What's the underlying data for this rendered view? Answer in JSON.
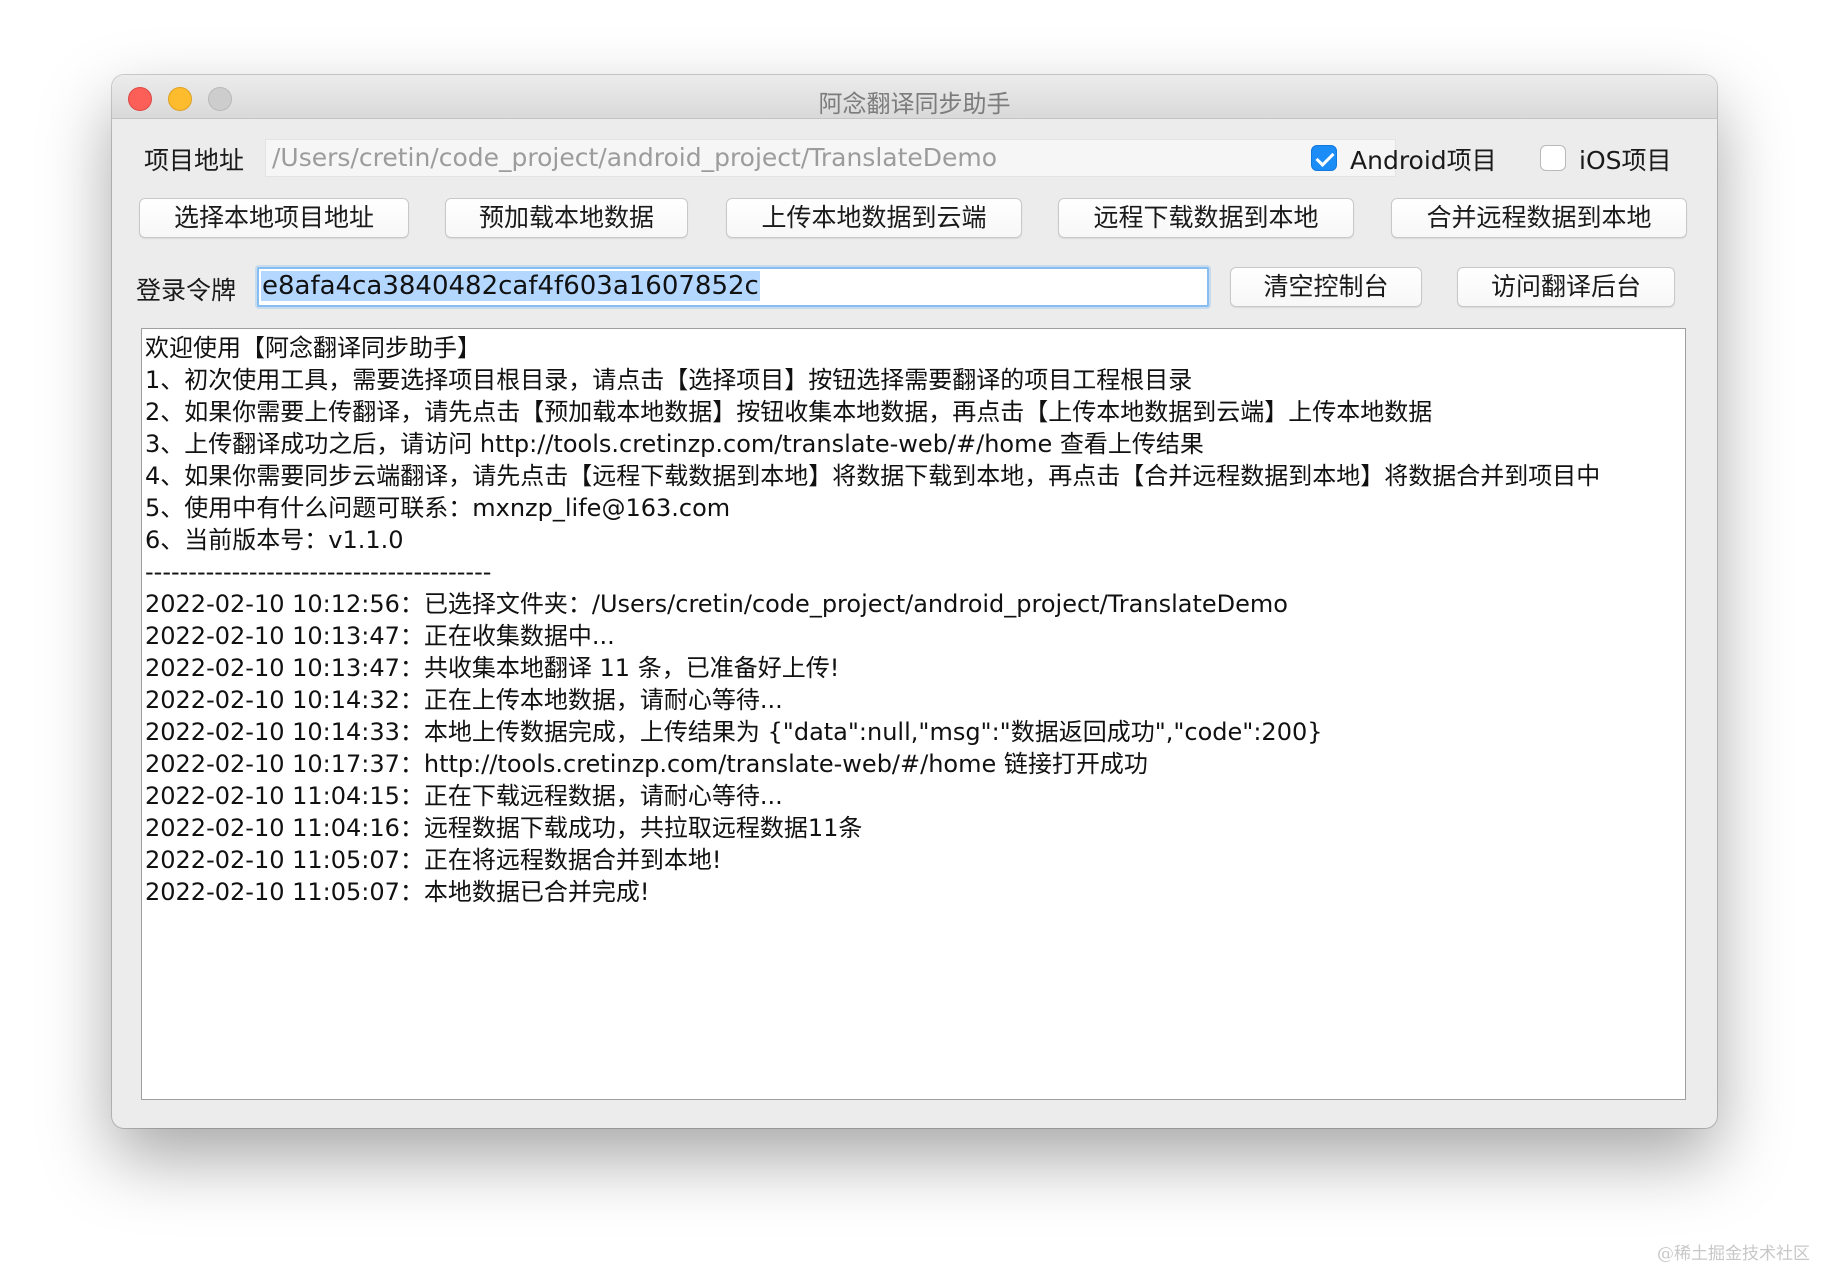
{
  "window": {
    "title": "阿念翻译同步助手",
    "traffic_colors": {
      "close": "#fc5f57",
      "minimize": "#fdbc2e",
      "zoom": "#cdcdcd"
    }
  },
  "project": {
    "label": "项目地址",
    "path_value": "/Users/cretin/code_project/android_project/TranslateDemo",
    "android_label": "Android项目",
    "android_checked": true,
    "ios_label": "iOS项目",
    "ios_checked": false
  },
  "actions": {
    "select_local": "选择本地项目地址",
    "preload_local": "预加载本地数据",
    "upload_cloud": "上传本地数据到云端",
    "download_remote": "远程下载数据到本地",
    "merge_remote": "合并远程数据到本地"
  },
  "token": {
    "label": "登录令牌",
    "value": "e8afa4ca3840482caf4f603a1607852c",
    "clear_console": "清空控制台",
    "visit_backend": "访问翻译后台"
  },
  "console": {
    "lines": [
      "欢迎使用【阿念翻译同步助手】",
      "1、初次使用工具，需要选择项目根目录，请点击【选择项目】按钮选择需要翻译的项目工程根目录",
      "2、如果你需要上传翻译，请先点击【预加载本地数据】按钮收集本地数据，再点击【上传本地数据到云端】上传本地数据",
      "3、上传翻译成功之后，请访问 http://tools.cretinzp.com/translate-web/#/home 查看上传结果",
      "4、如果你需要同步云端翻译，请先点击【远程下载数据到本地】将数据下载到本地，再点击【合并远程数据到本地】将数据合并到项目中",
      "5、使用中有什么问题可联系：mxnzp_life@163.com",
      "6、当前版本号：v1.1.0",
      "----------------------------------------",
      "2022-02-10 10:12:56：已选择文件夹：/Users/cretin/code_project/android_project/TranslateDemo",
      "2022-02-10 10:13:47：正在收集数据中...",
      "2022-02-10 10:13:47：共收集本地翻译 11 条，已准备好上传!",
      "2022-02-10 10:14:32：正在上传本地数据，请耐心等待...",
      "2022-02-10 10:14:33：本地上传数据完成，上传结果为 {\"data\":null,\"msg\":\"数据返回成功\",\"code\":200}",
      "2022-02-10 10:17:37：http://tools.cretinzp.com/translate-web/#/home 链接打开成功",
      "2022-02-10 11:04:15：正在下载远程数据，请耐心等待...",
      "2022-02-10 11:04:16：远程数据下载成功，共拉取远程数据11条",
      "2022-02-10 11:05:07：正在将远程数据合并到本地!",
      "2022-02-10 11:05:07：本地数据已合并完成!"
    ]
  },
  "watermark": "@稀土掘金技术社区",
  "colors": {
    "accent": "#1c8cf6",
    "selection": "#b3d7ff",
    "focus_ring": "#86bdf2"
  }
}
